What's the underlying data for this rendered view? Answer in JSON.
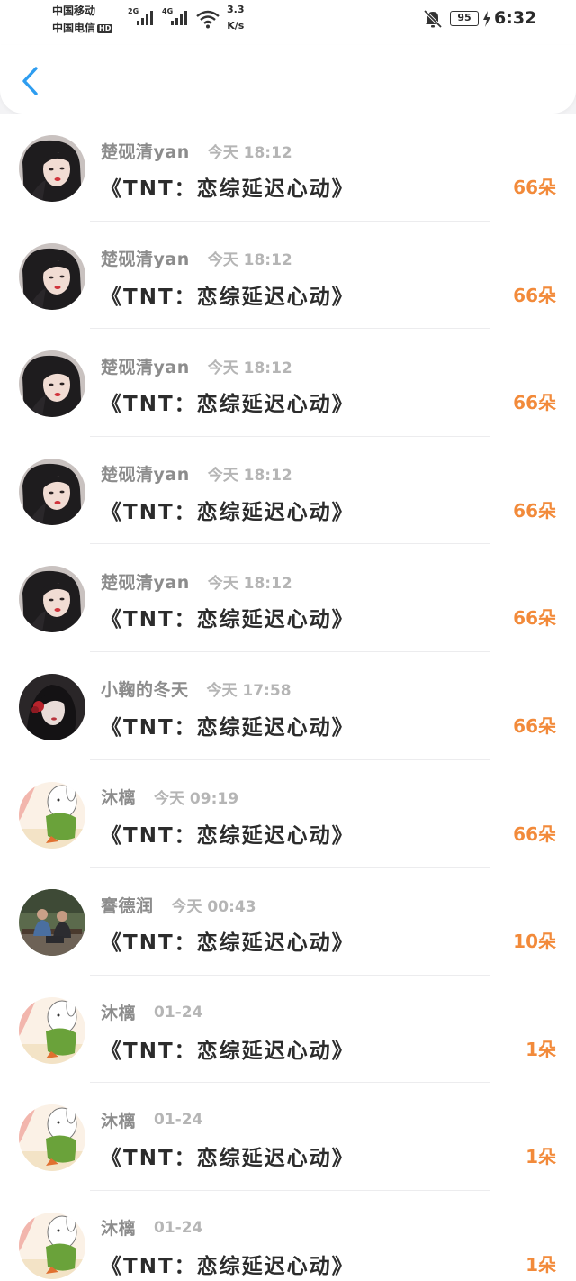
{
  "status_bar": {
    "carrier_1": "中国移动",
    "carrier_2": "中国电信",
    "hd_badge": "HD",
    "net_1": "2G",
    "net_2": "4G",
    "speed_value": "3.3",
    "speed_unit": "K/s",
    "battery": "95",
    "time": "6:32"
  },
  "colors": {
    "count": "#f28a3a",
    "back": "#2e9df0"
  },
  "items": [
    {
      "username": "楚砚清yan",
      "time": "今天 18:12",
      "title": "《TNT：恋综延迟心动》",
      "count": "66朵",
      "avatar": "girl-dark-hair-avatar"
    },
    {
      "username": "楚砚清yan",
      "time": "今天 18:12",
      "title": "《TNT：恋综延迟心动》",
      "count": "66朵",
      "avatar": "girl-dark-hair-avatar"
    },
    {
      "username": "楚砚清yan",
      "time": "今天 18:12",
      "title": "《TNT：恋综延迟心动》",
      "count": "66朵",
      "avatar": "girl-dark-hair-avatar"
    },
    {
      "username": "楚砚清yan",
      "time": "今天 18:12",
      "title": "《TNT：恋综延迟心动》",
      "count": "66朵",
      "avatar": "girl-dark-hair-avatar"
    },
    {
      "username": "楚砚清yan",
      "time": "今天 18:12",
      "title": "《TNT：恋综延迟心动》",
      "count": "66朵",
      "avatar": "girl-dark-hair-avatar"
    },
    {
      "username": "小鞠的冬天",
      "time": "今天 17:58",
      "title": "《TNT：恋综延迟心动》",
      "count": "66朵",
      "avatar": "girl-red-flower-avatar"
    },
    {
      "username": "沐樆",
      "time": "今天 09:19",
      "title": "《TNT：恋综延迟心动》",
      "count": "66朵",
      "avatar": "cartoon-bunny-avatar"
    },
    {
      "username": "謇德润",
      "time": "今天 00:43",
      "title": "《TNT：恋综延迟心动》",
      "count": "10朵",
      "avatar": "two-people-photo-avatar"
    },
    {
      "username": "沐樆",
      "time": "01-24",
      "title": "《TNT：恋综延迟心动》",
      "count": "1朵",
      "avatar": "cartoon-bunny-avatar"
    },
    {
      "username": "沐樆",
      "time": "01-24",
      "title": "《TNT：恋综延迟心动》",
      "count": "1朵",
      "avatar": "cartoon-bunny-avatar"
    },
    {
      "username": "沐樆",
      "time": "01-24",
      "title": "《TNT：恋综延迟心动》",
      "count": "1朵",
      "avatar": "cartoon-bunny-avatar"
    }
  ]
}
